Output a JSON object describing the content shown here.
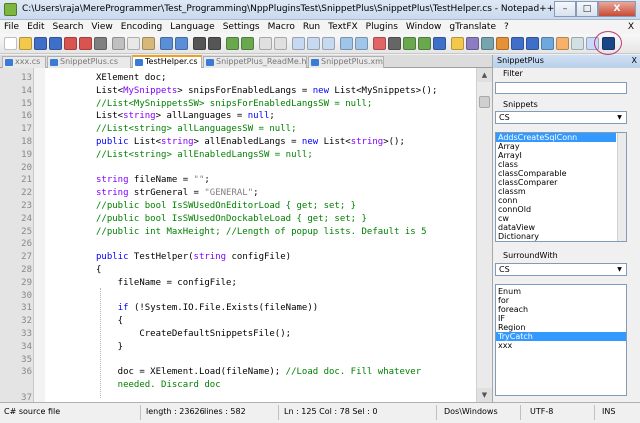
{
  "window": {
    "title": "C:\\Users\\raja\\MereProgrammer\\Test_Programming\\NppPluginsTest\\SnippetPlus\\SnippetPlus\\TestHelper.cs - Notepad++",
    "minimize": "–",
    "maximize": "□",
    "close": "X"
  },
  "menu": [
    "File",
    "Edit",
    "Search",
    "View",
    "Encoding",
    "Language",
    "Settings",
    "Macro",
    "Run",
    "TextFX",
    "Plugins",
    "Window",
    "gTranslate",
    "?"
  ],
  "menu_close": "X",
  "tabs": [
    {
      "label": "xxx.cs",
      "active": false
    },
    {
      "label": "SnippetPlus.cs",
      "active": false
    },
    {
      "label": "TestHelper.cs",
      "active": true
    },
    {
      "label": "SnippetPlus_ReadMe.html",
      "active": false
    },
    {
      "label": "SnippetPlus.xml",
      "active": false
    }
  ],
  "editor": {
    "line_numbers": [
      "13",
      "14",
      "15",
      "16",
      "17",
      "18",
      "19",
      "20",
      "21",
      "22",
      "23",
      "24",
      "25",
      "26",
      "27",
      "28",
      "29",
      "30",
      "31",
      "32",
      "33",
      "34",
      "35",
      "36",
      "",
      "37"
    ],
    "lines": [
      [
        {
          "t": "XElement doc;",
          "c": ""
        }
      ],
      [
        {
          "t": "List<",
          "c": ""
        },
        {
          "t": "MySnippets",
          "c": "ty"
        },
        {
          "t": "> snipsForEnabledLangs = ",
          "c": ""
        },
        {
          "t": "new",
          "c": "kw"
        },
        {
          "t": " List<MySnippets>();",
          "c": ""
        }
      ],
      [
        {
          "t": "//List<MySnippetsSW> snipsForEnabledLangsSW = null;",
          "c": "cm"
        }
      ],
      [
        {
          "t": "List<",
          "c": ""
        },
        {
          "t": "string",
          "c": "ty"
        },
        {
          "t": "> allLanguages = ",
          "c": ""
        },
        {
          "t": "null",
          "c": "kw"
        },
        {
          "t": ";",
          "c": ""
        }
      ],
      [
        {
          "t": "//List<string> allLanguagesSW = null;",
          "c": "cm"
        }
      ],
      [
        {
          "t": "public",
          "c": "kw"
        },
        {
          "t": " List<",
          "c": ""
        },
        {
          "t": "string",
          "c": "ty"
        },
        {
          "t": "> allEnabledLangs = ",
          "c": ""
        },
        {
          "t": "new",
          "c": "kw"
        },
        {
          "t": " List<",
          "c": ""
        },
        {
          "t": "string",
          "c": "ty"
        },
        {
          "t": ">();",
          "c": ""
        }
      ],
      [
        {
          "t": "//List<string> allEnabledLangsSW = null;",
          "c": "cm"
        }
      ],
      [
        {
          "t": "",
          "c": ""
        }
      ],
      [
        {
          "t": "string",
          "c": "ty"
        },
        {
          "t": " fileName = ",
          "c": ""
        },
        {
          "t": "\"\"",
          "c": "st"
        },
        {
          "t": ";",
          "c": ""
        }
      ],
      [
        {
          "t": "string",
          "c": "ty"
        },
        {
          "t": " strGeneral = ",
          "c": ""
        },
        {
          "t": "\"GENERAL\"",
          "c": "st"
        },
        {
          "t": ";",
          "c": ""
        }
      ],
      [
        {
          "t": "//public bool IsSWUsedOnEditorLoad { get; set; }",
          "c": "cm"
        }
      ],
      [
        {
          "t": "//public bool IsSWUsedOnDockableLoad { get; set; }",
          "c": "cm"
        }
      ],
      [
        {
          "t": "//public int MaxHeight; //Length of popup lists. Default is 5",
          "c": "cm"
        }
      ],
      [
        {
          "t": "",
          "c": ""
        }
      ],
      [
        {
          "t": "public",
          "c": "kw"
        },
        {
          "t": " TestHelper(",
          "c": ""
        },
        {
          "t": "string",
          "c": "ty"
        },
        {
          "t": " configFile)",
          "c": ""
        }
      ],
      [
        {
          "t": "{",
          "c": ""
        }
      ],
      [
        {
          "t": "    fileName = configFile;",
          "c": ""
        }
      ],
      [
        {
          "t": "",
          "c": ""
        }
      ],
      [
        {
          "t": "    ",
          "c": ""
        },
        {
          "t": "if",
          "c": "kw"
        },
        {
          "t": " (!System.IO.File.Exists(fileName))",
          "c": ""
        }
      ],
      [
        {
          "t": "    {",
          "c": ""
        }
      ],
      [
        {
          "t": "        CreateDefaultSnippetsFile();",
          "c": ""
        }
      ],
      [
        {
          "t": "    }",
          "c": ""
        }
      ],
      [
        {
          "t": "",
          "c": ""
        }
      ],
      [
        {
          "t": "    doc = XElement.Load(fileName); ",
          "c": ""
        },
        {
          "t": "//Load doc. Fill whatever",
          "c": "cm"
        }
      ],
      [
        {
          "t": "    needed. Discard doc",
          "c": "cm"
        }
      ],
      [
        {
          "t": "",
          "c": ""
        }
      ]
    ]
  },
  "panel": {
    "title": "SnippetPlus",
    "close": "X",
    "filter_label": "Filter",
    "filter_value": "",
    "snippets_label": "Snippets",
    "snippets_selected": "CS",
    "snippets_items": [
      "AddsCreateSqlConn",
      "Array",
      "ArrayI",
      "class",
      "classComparable",
      "classComparer",
      "classm",
      "conn",
      "connOld",
      "cw",
      "dataView",
      "Dictionary"
    ],
    "snippets_selected_index": 0,
    "surround_label": "SurroundWith",
    "surround_selected": "CS",
    "surround_items": [
      "Enum",
      "for",
      "foreach",
      "IF",
      "Region",
      "TryCatch",
      "xxx"
    ],
    "surround_selected_index": 5
  },
  "status": {
    "filetype": "C# source file",
    "length": "length : 23626",
    "lines": "lines : 582",
    "position": "Ln : 125   Col : 78   Sel : 0",
    "eol": "Dos\\Windows",
    "encoding": "UTF-8",
    "mode": "INS"
  },
  "colors": {
    "keyword": "#0000ff",
    "type": "#8000ff",
    "comment": "#008000",
    "string": "#808080",
    "selection": "#3399ff"
  }
}
